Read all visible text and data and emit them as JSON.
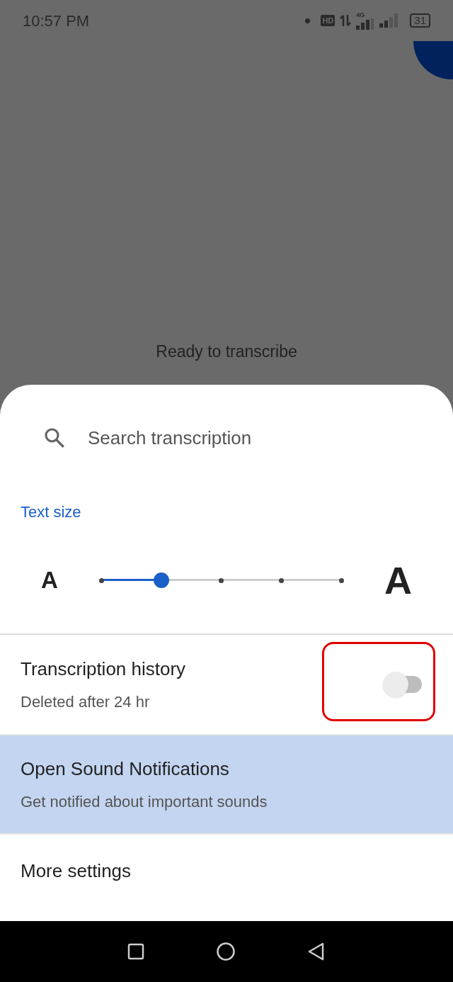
{
  "status_bar": {
    "time": "10:57 PM",
    "hd_badge": "HD",
    "network": "4G",
    "battery": "31"
  },
  "background": {
    "message": "Ready to transcribe"
  },
  "sheet": {
    "search": {
      "placeholder": "Search transcription"
    },
    "text_size": {
      "label": "Text size",
      "small_glyph": "A",
      "large_glyph": "A",
      "level": 0.25
    },
    "items": [
      {
        "kind": "toggle",
        "title": "Transcription history",
        "subtitle": "Deleted after 24 hr",
        "on": false,
        "highlighted": false,
        "annotated": true
      },
      {
        "kind": "link",
        "title": "Open Sound Notifications",
        "subtitle": "Get notified about important sounds",
        "highlighted": true,
        "annotated": false
      },
      {
        "kind": "link",
        "title": "More settings",
        "highlighted": false,
        "annotated": false
      }
    ]
  }
}
